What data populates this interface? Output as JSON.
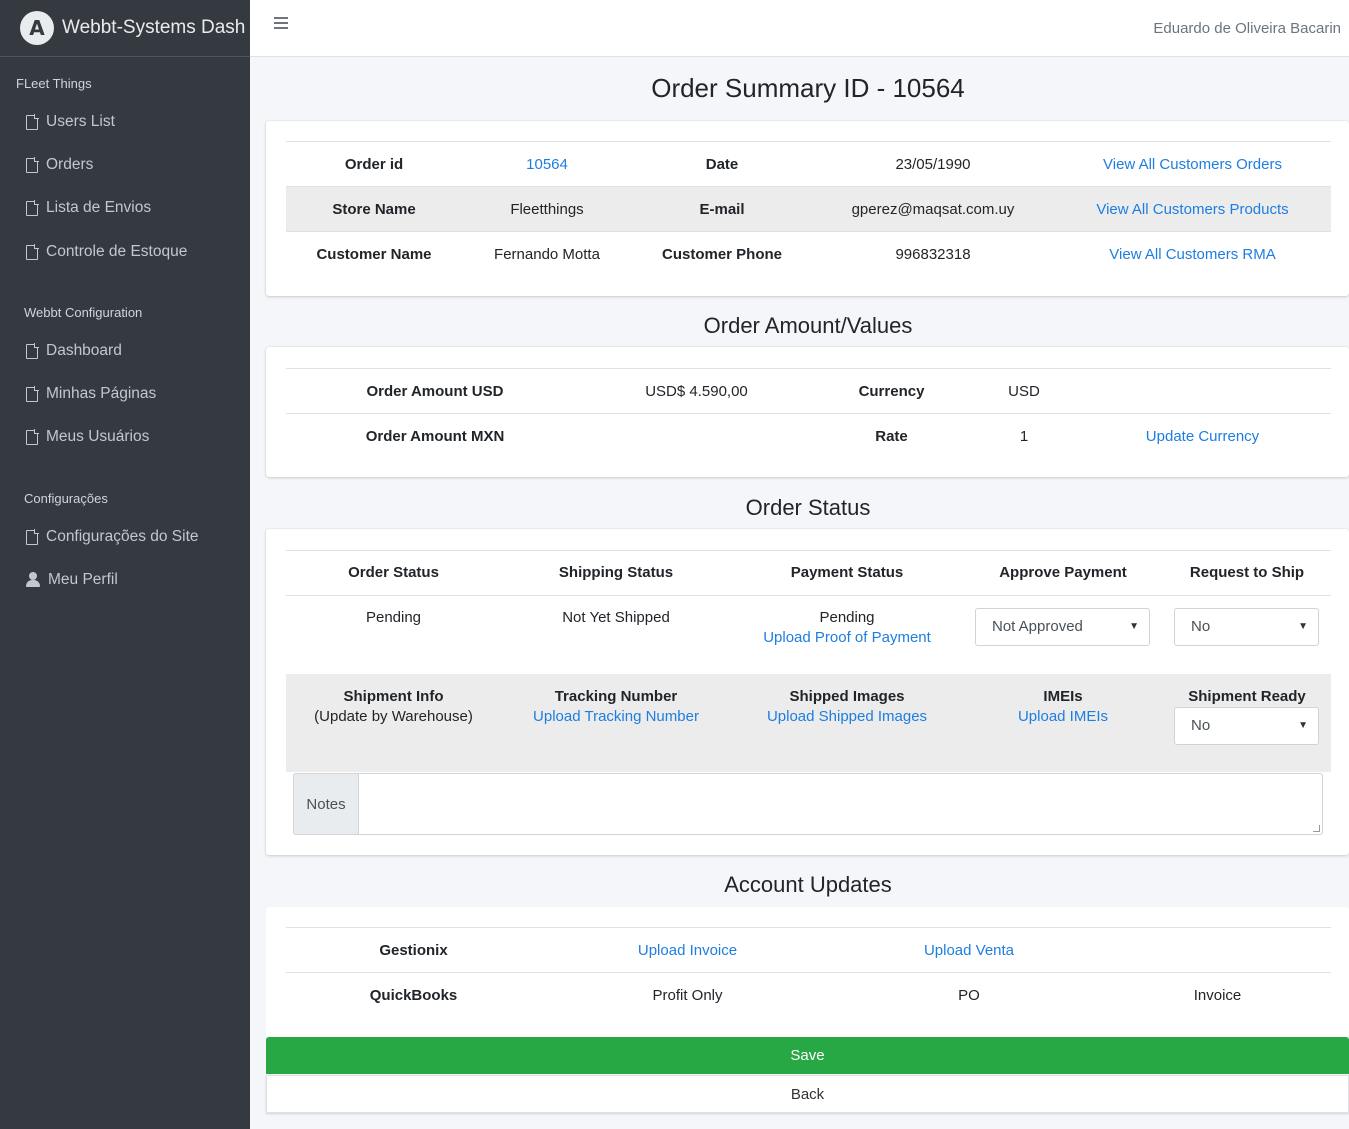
{
  "brand": {
    "logo_letter": "A",
    "name": "Webbt-Systems Dash"
  },
  "sidebar": {
    "sections": [
      {
        "header": "FLeet Things",
        "items": [
          "Users List",
          "Orders",
          "Lista de Envios",
          "Controle de Estoque"
        ]
      },
      {
        "header": "Webbt Configuration",
        "items": [
          "Dashboard",
          "Minhas Páginas",
          "Meus Usuários"
        ]
      },
      {
        "header": "Configurações",
        "items": [
          "Configurações do Site",
          "Meu Perfil"
        ]
      }
    ]
  },
  "topbar": {
    "user_name": "Eduardo de Oliveira Bacarin"
  },
  "summary": {
    "title": "Order Summary ID - 10564",
    "order_id_label": "Order id",
    "order_id_value": "10564",
    "date_label": "Date",
    "date_value": "23/05/1990",
    "link_orders": "View All Customers Orders",
    "store_label": "Store Name",
    "store_value": "Fleetthings",
    "email_label": "E-mail",
    "email_value": "gperez@maqsat.com.uy",
    "link_products": "View All Customers Products",
    "customer_label": "Customer Name",
    "customer_value": "Fernando Motta",
    "phone_label": "Customer Phone",
    "phone_value": "996832318",
    "link_rma": "View All Customers RMA"
  },
  "amount": {
    "title": "Order Amount/Values",
    "usd_label": "Order Amount USD",
    "usd_value": "USD$ 4.590,00",
    "currency_label": "Currency",
    "currency_value": "USD",
    "mxn_label": "Order Amount MXN",
    "mxn_value": "",
    "rate_label": "Rate",
    "rate_value": "1",
    "update_link": "Update Currency"
  },
  "status": {
    "title": "Order Status",
    "order_status_label": "Order Status",
    "order_status_value": "Pending",
    "shipping_status_label": "Shipping Status",
    "shipping_status_value": "Not Yet Shipped",
    "payment_status_label": "Payment Status",
    "payment_status_value": "Pending",
    "upload_proof_link": "Upload Proof of Payment",
    "approve_payment_label": "Approve Payment",
    "approve_payment_selected": "Not Approved",
    "request_ship_label": "Request to Ship",
    "request_ship_selected": "No",
    "shipment_info_label": "Shipment Info",
    "shipment_info_sub": "(Update by Warehouse)",
    "tracking_label": "Tracking Number",
    "tracking_link": "Upload Tracking Number",
    "shipped_images_label": "Shipped Images",
    "shipped_images_link": "Upload Shipped Images",
    "imeis_label": "IMEIs",
    "imeis_link": "Upload IMEIs",
    "shipment_ready_label": "Shipment Ready",
    "shipment_ready_selected": "No",
    "notes_label": "Notes",
    "notes_value": ""
  },
  "account": {
    "title": "Account Updates",
    "gestionix_label": "Gestionix",
    "upload_invoice_link": "Upload Invoice",
    "upload_venta_link": "Upload Venta",
    "quickbooks_label": "QuickBooks",
    "profit_only": "Profit Only",
    "po": "PO",
    "invoice": "Invoice"
  },
  "actions": {
    "save": "Save",
    "back": "Back"
  },
  "colors": {
    "sidebar_bg": "#343a40",
    "link": "#1e7ee0",
    "save_green": "#28a745",
    "row_shade": "#ececec"
  }
}
